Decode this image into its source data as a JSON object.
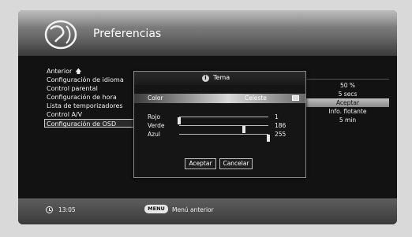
{
  "header": {
    "title": "Preferencias"
  },
  "menu": {
    "items": [
      {
        "label": "Anterior"
      },
      {
        "label": "Configuración de idioma"
      },
      {
        "label": "Control parental"
      },
      {
        "label": "Configuración de hora"
      },
      {
        "label": "Lista de temporizadores"
      },
      {
        "label": "Control A/V"
      },
      {
        "label": "Configuración de OSD",
        "selected": true
      }
    ]
  },
  "values": [
    {
      "label": "50 %"
    },
    {
      "label": "5 secs"
    },
    {
      "label": "Aceptar",
      "selected": true
    },
    {
      "label": "Info. flotante"
    },
    {
      "label": "5 min"
    }
  ],
  "dialog": {
    "title": "Tema",
    "color_label": "Color",
    "color_value": "Celeste",
    "sliders": [
      {
        "label": "Rojo",
        "value": "1",
        "max": 255
      },
      {
        "label": "Verde",
        "value": "186",
        "max": 255
      },
      {
        "label": "Azul",
        "value": "255",
        "max": 255
      }
    ],
    "ok_label": "Aceptar",
    "cancel_label": "Cancelar"
  },
  "footer": {
    "time": "13:05",
    "menu_key": "MENU",
    "menu_key_label": "Menú anterior"
  },
  "colors": {
    "accent": "#d8d8d8",
    "background": "#121212"
  }
}
